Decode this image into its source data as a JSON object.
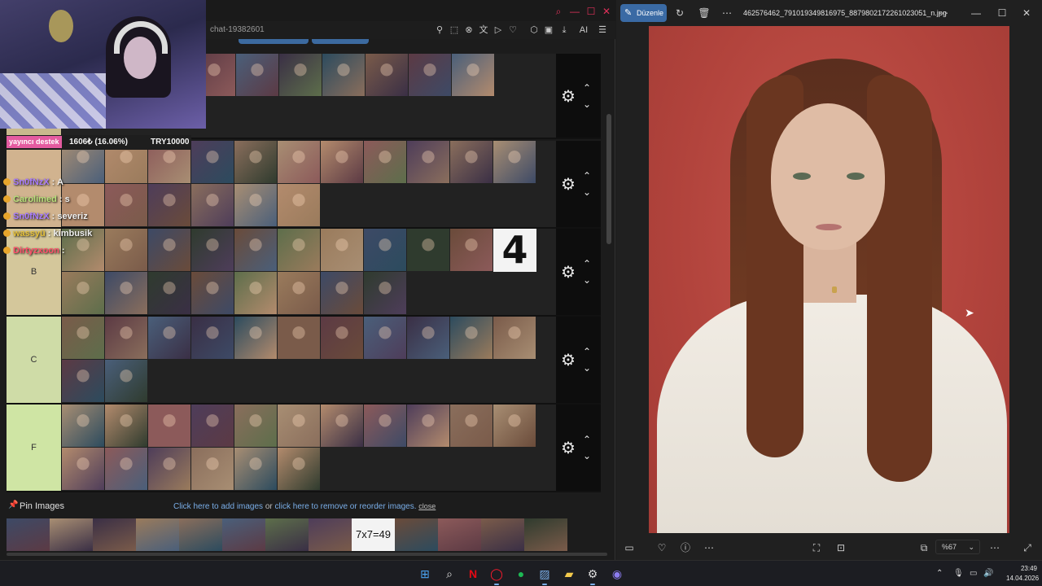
{
  "browser": {
    "url_fragment": "chat-19382601",
    "toolbar_icons": [
      "bookmark-icon",
      "screenshot-icon",
      "block-icon",
      "translate-icon",
      "play-icon",
      "heart-icon",
      "extensions-icon",
      "download-icon",
      "ai-icon",
      "menu-icon"
    ],
    "ai_label": "AI"
  },
  "stream_overlay": {
    "donation_tag": "yayıncı destek",
    "donation_amount": "1606₺ (16.06%)",
    "donation_goal": "TRY10000",
    "chat": [
      {
        "user": "Sn0fNzX",
        "message": ": A",
        "color": "#a77bff"
      },
      {
        "user": "Carolimed",
        "message": ": s",
        "color": "#b7e07a"
      },
      {
        "user": "Sn0fNzX",
        "message": ": severiz",
        "color": "#a77bff"
      },
      {
        "user": "wassyü",
        "message": ": kimbusik",
        "color": "#e7c23a"
      },
      {
        "user": "Dirtyzxoon",
        "message": ":",
        "color": "#ff4f6a"
      }
    ]
  },
  "tiers": [
    {
      "label": "",
      "color": "#c9b98d",
      "rows": 1,
      "count": 8
    },
    {
      "label": "",
      "color": "#d1b38f",
      "rows": 2,
      "count": 17
    },
    {
      "label": "B",
      "color": "#d4c79b",
      "rows": 2,
      "count": 19,
      "has_four": true
    },
    {
      "label": "C",
      "color": "#cfdca7",
      "rows": 2,
      "count": 13
    },
    {
      "label": "F",
      "color": "#cfe5a4",
      "rows": 2,
      "count": 17
    }
  ],
  "big_four_text": "4",
  "pin_bar": {
    "title": "Pin Images",
    "add_link": "Click here to add images",
    "or_text": "or",
    "remove_link": "click here to remove or reorder images.",
    "close": "close",
    "text_thumb": "7x7=49"
  },
  "viewer": {
    "edit_label": "Düzenle",
    "file_name": "462576462_791019349816975_8879802172261023051_n.jpg",
    "zoom": "%67"
  },
  "taskbar": {
    "time": "23:49",
    "date": "14.04.2026"
  },
  "colors": {
    "accent": "#3a6aa4",
    "opera_red": "#e0315a"
  }
}
